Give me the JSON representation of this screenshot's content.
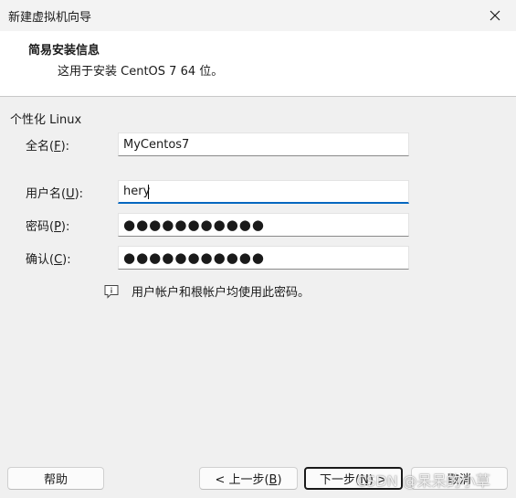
{
  "window": {
    "title": "新建虚拟机向导"
  },
  "header": {
    "title": "简易安装信息",
    "subtitle": "这用于安装 CentOS 7 64 位。"
  },
  "section": {
    "label": "个性化 Linux"
  },
  "fields": {
    "fullname": {
      "label_prefix": "全名(",
      "accel": "F",
      "label_suffix": "):",
      "value": "MyCentos7"
    },
    "username": {
      "label_prefix": "用户名(",
      "accel": "U",
      "label_suffix": "):",
      "value": "hery"
    },
    "password": {
      "label_prefix": "密码(",
      "accel": "P",
      "label_suffix": "):",
      "value": "●●●●●●●●●●●"
    },
    "confirm": {
      "label_prefix": "确认(",
      "accel": "C",
      "label_suffix": "):",
      "value": "●●●●●●●●●●●"
    }
  },
  "info": {
    "text": "用户帐户和根帐户均使用此密码。"
  },
  "buttons": {
    "help": "帮助",
    "back_prefix": "< 上一步(",
    "back_accel": "B",
    "back_suffix": ")",
    "next_prefix": "下一步(",
    "next_accel": "N",
    "next_suffix": ") >",
    "cancel": "取消"
  },
  "watermark": "CSDN @呆呆的小草",
  "colors": {
    "accent": "#0067c0",
    "window_bg": "#f0f0f0",
    "header_bg": "#ffffff"
  }
}
